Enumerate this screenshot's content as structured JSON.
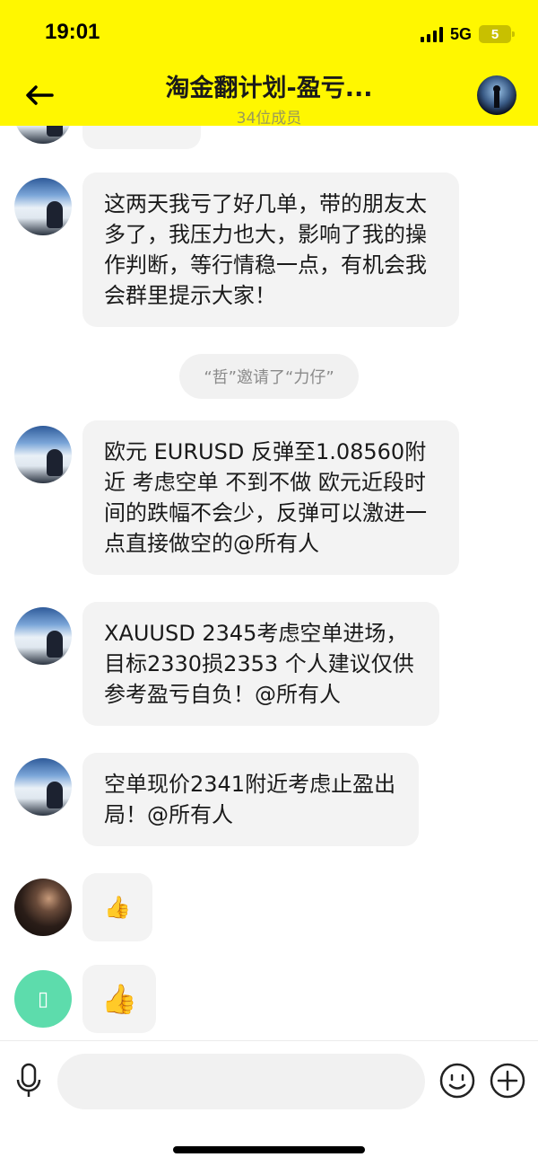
{
  "status_bar": {
    "time": "19:01",
    "network": "5G",
    "battery": "5"
  },
  "header": {
    "title": "淘金翻计划-盈亏...",
    "subtitle": "34位成员",
    "colors": {
      "background": "#fff700"
    }
  },
  "messages": [
    {
      "type": "partial",
      "text": ""
    },
    {
      "type": "text",
      "text": "这两天我亏了好几单，带的朋友太多了，我压力也大，影响了我的操作判断，等行情稳一点，有机会我会群里提示大家！"
    },
    {
      "type": "system",
      "text": "“哲”邀请了“力仔”"
    },
    {
      "type": "text",
      "text": "欧元 EURUSD 反弹至1.08560附近 考虑空单 不到不做  欧元近段时间的跌幅不会少，反弹可以激进一点直接做空的@所有人"
    },
    {
      "type": "text",
      "text": "XAUUSD  2345考虑空单进场，目标2330损2353 个人建议仅供参考盈亏自负！@所有人"
    },
    {
      "type": "text",
      "text": "空单现价2341附近考虑止盈出局！@所有人"
    },
    {
      "type": "emoji",
      "text": "👍"
    },
    {
      "type": "emoji",
      "text": "👍"
    }
  ],
  "input": {
    "placeholder": "",
    "value": ""
  },
  "icons": [
    "back-arrow-icon",
    "group-avatar",
    "microphone-icon",
    "emoji-icon",
    "plus-icon"
  ]
}
